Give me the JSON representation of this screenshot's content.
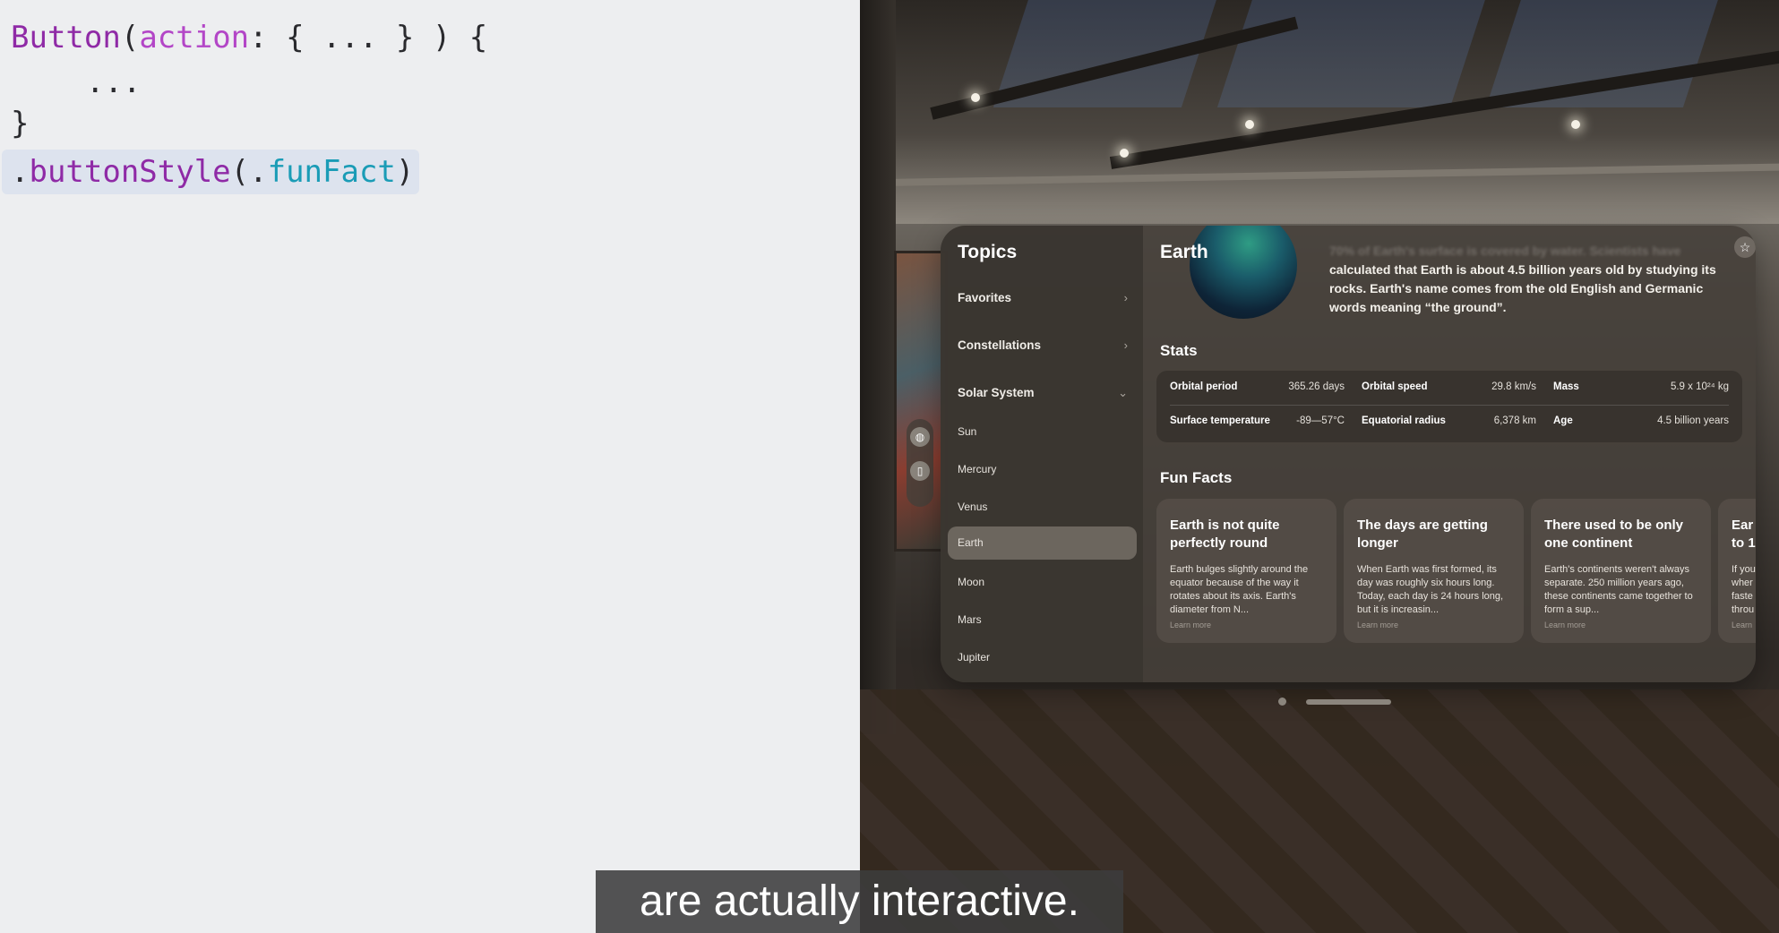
{
  "code": {
    "line1": {
      "type": "Button",
      "paren_open": "(",
      "param": "action",
      "rest": ": { ... } ) {"
    },
    "line2": "...",
    "line3": "}",
    "line4": {
      "dot": ".",
      "method": "buttonStyle",
      "paren_open": "(.",
      "member": "funFact",
      "paren_close": ")"
    }
  },
  "sidebar": {
    "title": "Topics",
    "sections": [
      {
        "label": "Favorites",
        "chevron": "›"
      },
      {
        "label": "Constellations",
        "chevron": "›"
      },
      {
        "label": "Solar System",
        "chevron": "⌄"
      }
    ],
    "items": [
      "Sun",
      "Mercury",
      "Venus",
      "Earth",
      "Moon",
      "Mars",
      "Jupiter"
    ],
    "selected": "Earth"
  },
  "ornament": {
    "globe_icon": "globe-icon",
    "book_icon": "book-icon"
  },
  "detail": {
    "title": "Earth",
    "blurb_faded": "70% of Earth's surface is covered by water. Scientists have",
    "blurb": "calculated that Earth is about 4.5 billion years old by studying its rocks. Earth's name comes from the old English and Germanic words meaning “the ground”.",
    "favorite_icon": "star-icon"
  },
  "stats": {
    "heading": "Stats",
    "rows": [
      [
        {
          "label": "Orbital period",
          "value": "365.26 days"
        },
        {
          "label": "Orbital speed",
          "value": "29.8 km/s"
        },
        {
          "label": "Mass",
          "value": "5.9 x 10²⁴ kg"
        }
      ],
      [
        {
          "label": "Surface temperature",
          "value": "-89—57°C"
        },
        {
          "label": "Equatorial radius",
          "value": "6,378 km"
        },
        {
          "label": "Age",
          "value": "4.5 billion years"
        }
      ]
    ]
  },
  "fun_facts": {
    "heading": "Fun Facts",
    "cards": [
      {
        "title": "Earth is not quite perfectly round",
        "body": "Earth bulges slightly around the equator because of the way it rotates about its axis. Earth's diameter from N...",
        "more": "Learn more"
      },
      {
        "title": "The days are getting longer",
        "body": "When Earth was first formed, its day was roughly six hours long. Today, each day is 24 hours long, but it is increasin...",
        "more": "Learn more"
      },
      {
        "title": "There used to be only one continent",
        "body": "Earth's continents weren't always separate. 250 million years ago, these continents came together to form a sup...",
        "more": "Learn more"
      },
      {
        "title": "Ear to 1",
        "body": "If you wher faste throu",
        "more": "Learn"
      }
    ]
  },
  "caption": "are actually interactive."
}
